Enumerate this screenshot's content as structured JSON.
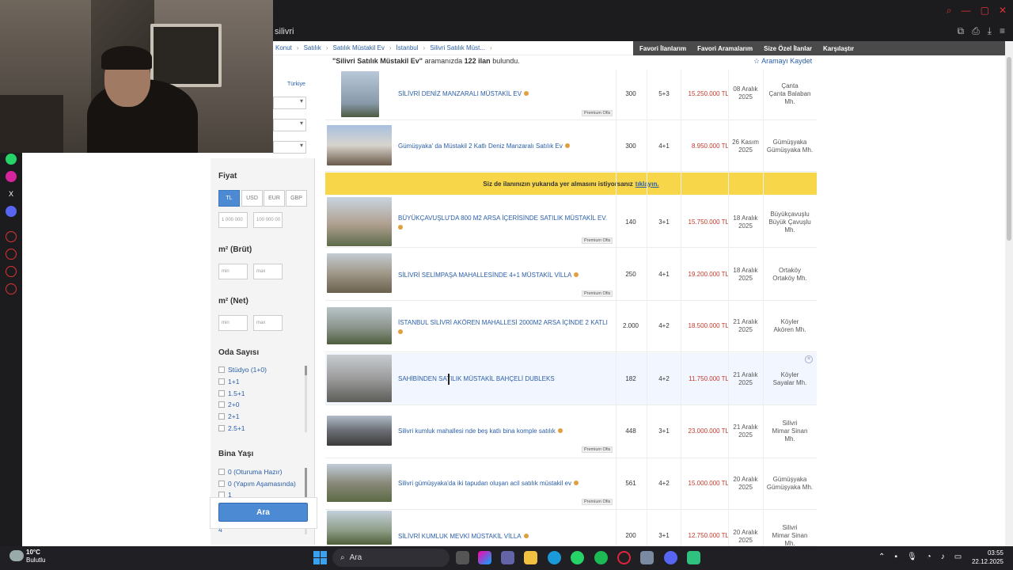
{
  "browser": {
    "tab_text": "silivri"
  },
  "breadcrumb": [
    "Konut",
    "Satılık",
    "Satılık Müstakil Ev",
    "İstanbul",
    "Silivri Satılık Müst..."
  ],
  "top_links": [
    "Favori İlanlarım",
    "Favori Aramalarım",
    "Size Özel İlanlar",
    "Karşılaştır"
  ],
  "results": {
    "query": "\"Silivri Satılık Müstakil Ev\"",
    "middle": "aramanızda",
    "count": "122 ilan",
    "tail": "bulundu.",
    "save_label": "Aramayı Kaydet"
  },
  "filters": {
    "country": "Türkiye",
    "price_label": "Fiyat",
    "currencies": [
      "TL",
      "USD",
      "EUR",
      "GBP"
    ],
    "price_min": "1 000 000",
    "price_max": "100 000 00",
    "m2_brut_label": "m² (Brüt)",
    "m2_net_label": "m² (Net)",
    "min_ph": "min",
    "max_ph": "max",
    "room_label": "Oda Sayısı",
    "rooms": [
      "Stüdyo (1+0)",
      "1+1",
      "1.5+1",
      "2+0",
      "2+1",
      "2.5+1"
    ],
    "age_label": "Bina Yaşı",
    "ages": [
      "0 (Oturuma Hazır)",
      "0 (Yapım Aşamasında)",
      "1",
      "4"
    ],
    "search_button": "Ara"
  },
  "promo": {
    "text": "Siz de ilanınızın yukarıda yer almasını istiyorsanız",
    "link": "tıklayın."
  },
  "premium_label": "Premium Ofis",
  "listings": [
    {
      "title": "SİLİVRİ DENİZ MANZARALI MÜSTAKİL EV",
      "m2": "300",
      "rooms": "5+3",
      "price": "15.250.000 TL",
      "date1": "08 Aralık",
      "date2": "2025",
      "loc1": "Çanta",
      "loc2": "Çanta Balaban",
      "loc3": "Mh."
    },
    {
      "title": "Gümüşyaka' da Müstakil 2 Katlı Deniz Manzaralı Satılık Ev",
      "m2": "300",
      "rooms": "4+1",
      "price": "8.950.000 TL",
      "date1": "26 Kasım",
      "date2": "2025",
      "loc1": "Gümüşyaka",
      "loc2": "Gümüşyaka Mh.",
      "loc3": ""
    },
    {
      "title": "BÜYÜKÇAVUŞLU'DA 800 M2 ARSA İÇERİSİNDE SATILIK MÜSTAKİL EV.",
      "m2": "140",
      "rooms": "3+1",
      "price": "15.750.000 TL",
      "date1": "18 Aralık",
      "date2": "2025",
      "loc1": "Büyükçavuşlu",
      "loc2": "Büyük Çavuşlu",
      "loc3": "Mh."
    },
    {
      "title": "SİLİVRİ SELİMPAŞA MAHALLESİNDE 4+1 MÜSTAKİL VİLLA",
      "m2": "250",
      "rooms": "4+1",
      "price": "19.200.000 TL",
      "date1": "18 Aralık",
      "date2": "2025",
      "loc1": "Ortaköy",
      "loc2": "Ortaköy Mh.",
      "loc3": ""
    },
    {
      "title": "İSTANBUL SİLİVRİ AKÖREN MAHALLESİ 2000M2 ARSA İÇİNDE 2 KATLI",
      "m2": "2.000",
      "rooms": "4+2",
      "price": "18.500.000 TL",
      "date1": "21 Aralık",
      "date2": "2025",
      "loc1": "Köyler",
      "loc2": "Akören Mh.",
      "loc3": ""
    },
    {
      "title": "SAHİBİNDEN SATILIK MÜSTAKİL BAHÇELİ DUBLEKS",
      "m2": "182",
      "rooms": "4+2",
      "price": "11.750.000 TL",
      "date1": "21 Aralık",
      "date2": "2025",
      "loc1": "Köyler",
      "loc2": "Sayalar Mh.",
      "loc3": ""
    },
    {
      "title": "Silivri kumluk mahallesi nde beş katlı bina komple satılık",
      "m2": "448",
      "rooms": "3+1",
      "price": "23.000.000 TL",
      "date1": "21 Aralık",
      "date2": "2025",
      "loc1": "Silivri",
      "loc2": "Mimar Sinan",
      "loc3": "Mh."
    },
    {
      "title": "Silivri gümüşyaka'da iki tapudan oluşan acil satılık müstakil ev",
      "m2": "561",
      "rooms": "4+2",
      "price": "15.000.000 TL",
      "date1": "20 Aralık",
      "date2": "2025",
      "loc1": "Gümüşyaka",
      "loc2": "Gümüşyaka Mh.",
      "loc3": ""
    },
    {
      "title": "SİLİVRİ KUMLUK MEVKİ MÜSTAKİL VİLLA",
      "m2": "200",
      "rooms": "3+1",
      "price": "12.750.000 TL",
      "date1": "20 Aralık",
      "date2": "2025",
      "loc1": "Silivri",
      "loc2": "Mimar Sinan",
      "loc3": "Mh."
    }
  ],
  "taskbar": {
    "temp": "10°C",
    "weather": "Bulutlu",
    "search": "Ara",
    "time": "03:55",
    "date": "22.12.2025"
  }
}
